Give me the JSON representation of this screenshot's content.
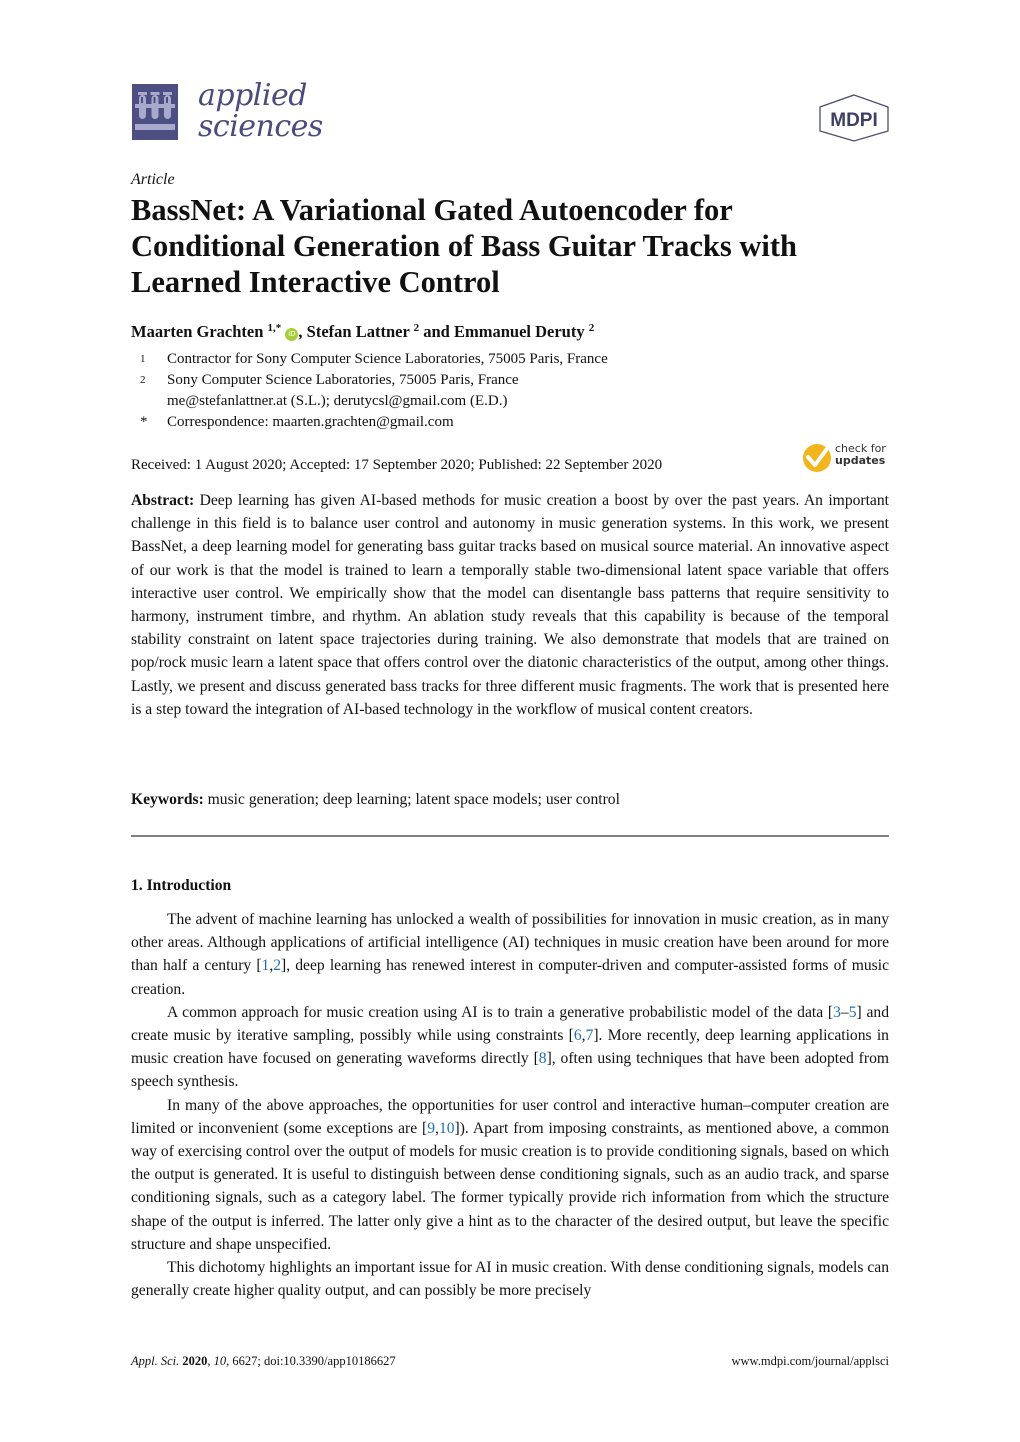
{
  "header": {
    "journal_name_line1": "applied",
    "journal_name_line2": "sciences",
    "publisher_logo": "MDPI",
    "journal_logo_icon": "test-tubes-icon",
    "brand_color": "#4d4f83"
  },
  "article": {
    "type": "Article",
    "title": "BassNet: A Variational Gated Autoencoder for Conditional Generation of Bass Guitar Tracks with Learned Interactive Control",
    "authors": [
      {
        "name": "Maarten Grachten",
        "affil": "1,*",
        "orcid": true
      },
      {
        "name": "Stefan Lattner",
        "affil": "2"
      },
      {
        "name": "Emmanuel Deruty",
        "affil": "2"
      }
    ],
    "author_separators": [
      ", ",
      " and "
    ],
    "affiliations": [
      {
        "mark": "1",
        "text": "Contractor for Sony Computer Science Laboratories, 75005 Paris, France"
      },
      {
        "mark": "2",
        "text": "Sony Computer Science Laboratories, 75005 Paris, France"
      },
      {
        "mark": "",
        "text": "me@stefanlattner.at (S.L.); derutycsl@gmail.com (E.D.)"
      },
      {
        "mark": "*",
        "text": "Correspondence: maarten.grachten@gmail.com"
      }
    ],
    "dates": "Received: 1 August 2020; Accepted: 17 September 2020; Published: 22 September 2020",
    "check_updates": {
      "line1": "check for",
      "line2": "updates",
      "color": "#f2b51c"
    },
    "abstract_label": "Abstract:",
    "abstract": "Deep learning has given AI-based methods for music creation a boost by over the past years. An important challenge in this field is to balance user control and autonomy in music generation systems. In this work, we present BassNet, a deep learning model for generating bass guitar tracks based on musical source material. An innovative aspect of our work is that the model is trained to learn a temporally stable two-dimensional latent space variable that offers interactive user control. We empirically show that the model can disentangle bass patterns that require sensitivity to harmony, instrument timbre, and rhythm.  An ablation study reveals that this capability is because of the temporal stability constraint on latent space trajectories during training. We also demonstrate that models that are trained on pop/rock music learn a latent space that offers control over the diatonic characteristics of the output, among other things. Lastly, we present and discuss generated bass tracks for three different music fragments. The work that is presented here is a step toward the integration of AI-based technology in the workflow of musical content creators.",
    "keywords_label": "Keywords:",
    "keywords": "music generation; deep learning; latent space models; user control"
  },
  "section": {
    "heading": "1. Introduction",
    "paragraphs": [
      [
        {
          "t": "The advent of machine learning has unlocked a wealth of possibilities for innovation in music creation, as in many other areas.  Although applications of artificial intelligence (AI) techniques in music creation have been around for more than half a century ["
        },
        {
          "r": "1"
        },
        {
          "t": ","
        },
        {
          "r": "2"
        },
        {
          "t": "], deep learning has renewed interest in computer-driven and computer-assisted forms of music creation."
        }
      ],
      [
        {
          "t": "A common approach for music creation using AI is to train a generative probabilistic model of the data ["
        },
        {
          "r": "3"
        },
        {
          "t": "–"
        },
        {
          "r": "5"
        },
        {
          "t": "] and create music by iterative sampling, possibly while using constraints ["
        },
        {
          "r": "6"
        },
        {
          "t": ","
        },
        {
          "r": "7"
        },
        {
          "t": "]. More recently, deep learning applications in music creation have focused on generating waveforms directly ["
        },
        {
          "r": "8"
        },
        {
          "t": "], often using techniques that have been adopted from speech synthesis."
        }
      ],
      [
        {
          "t": "In many of the above approaches, the opportunities for user control and interactive human–computer creation are limited or inconvenient (some exceptions are ["
        },
        {
          "r": "9"
        },
        {
          "t": ","
        },
        {
          "r": "10"
        },
        {
          "t": "]).  Apart from imposing constraints, as mentioned above, a common way of exercising control over the output of models for music creation is to provide conditioning signals, based on which the output is generated. It is useful to distinguish between dense conditioning signals, such as an audio track, and sparse conditioning signals, such as a category label. The former typically provide rich information from which the structure shape of the output is inferred. The latter only give a hint as to the character of the desired output, but leave the specific structure and shape unspecified."
        }
      ],
      [
        {
          "t": "This dichotomy highlights an important issue for AI in music creation. With dense conditioning signals, models can generally create higher quality output, and can possibly be more precisely"
        }
      ]
    ]
  },
  "footer": {
    "journal_abbrev": "Appl. Sci.",
    "year": "2020",
    "volume": "10",
    "rest": ", 6627; doi:10.3390/app10186627",
    "url": "www.mdpi.com/journal/applsci"
  }
}
